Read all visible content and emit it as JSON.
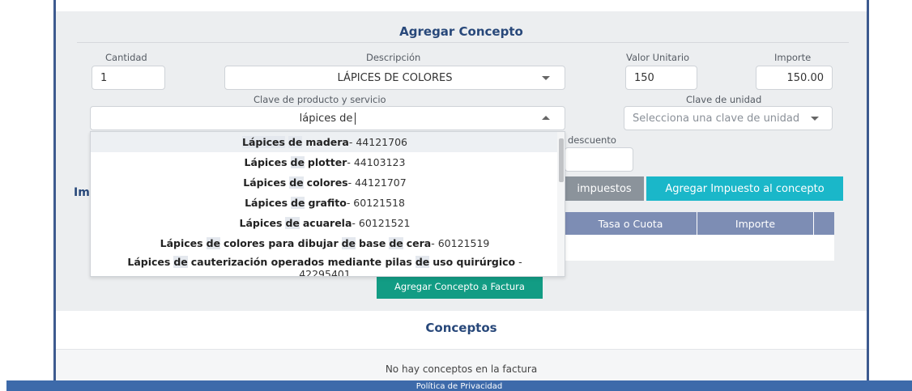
{
  "form": {
    "title": "Agregar Concepto",
    "cantidad_label": "Cantidad",
    "cantidad_value": "1",
    "descripcion_label": "Descripción",
    "descripcion_value": "LÁPICES DE COLORES",
    "valor_unitario_label": "Valor Unitario",
    "valor_unitario_value": "150",
    "importe_label": "Importe",
    "importe_value": "150.00",
    "clave_producto_label": "Clave de producto y servicio",
    "clave_producto_query": "lápices de",
    "clave_unidad_label": "Clave de unidad",
    "clave_unidad_placeholder": "Selecciona una clave de unidad",
    "descuento_label": "descuento",
    "side_label": "Im",
    "impuestos_button": "impuestos",
    "agregar_impuesto_button": "Agregar Impuesto al concepto",
    "agregar_concepto_button": "Agregar Concepto a Factura"
  },
  "tax_table": {
    "columns": [
      "Tasa o Cuota",
      "Importe",
      ""
    ]
  },
  "dropdown": {
    "options": [
      {
        "w1": "Lápices",
        "w2": "de",
        "rest": "madera",
        "code": " - 44121706"
      },
      {
        "w1": "Lápices",
        "w2": "de",
        "rest": "plotter",
        "code": " - 44103123"
      },
      {
        "w1": "Lápices",
        "w2": "de",
        "rest": "colores",
        "code": " - 44121707"
      },
      {
        "w1": "Lápices",
        "w2": "de",
        "rest": "grafito",
        "code": " - 60121518"
      },
      {
        "w1": "Lápices",
        "w2": "de",
        "rest": "acuarela",
        "code": " - 60121521"
      },
      {
        "w1": "Lápices",
        "w2": "de",
        "rest_a": "colores para dibujar",
        "w3": "de",
        "rest_b": "base",
        "w4": "de",
        "rest_c": "cera",
        "code": " - 60121519"
      },
      {
        "w1": "Lápices",
        "w2": "de",
        "rest_a": "cauterización operados mediante pilas",
        "w3": "de",
        "rest_b": "uso quirúrgico",
        "code_line2": "42295401",
        "code": " -"
      }
    ]
  },
  "conceptos": {
    "title": "Conceptos",
    "empty_message": "No hay conceptos en la factura"
  },
  "footer": {
    "link": "Política de Privacidad"
  }
}
